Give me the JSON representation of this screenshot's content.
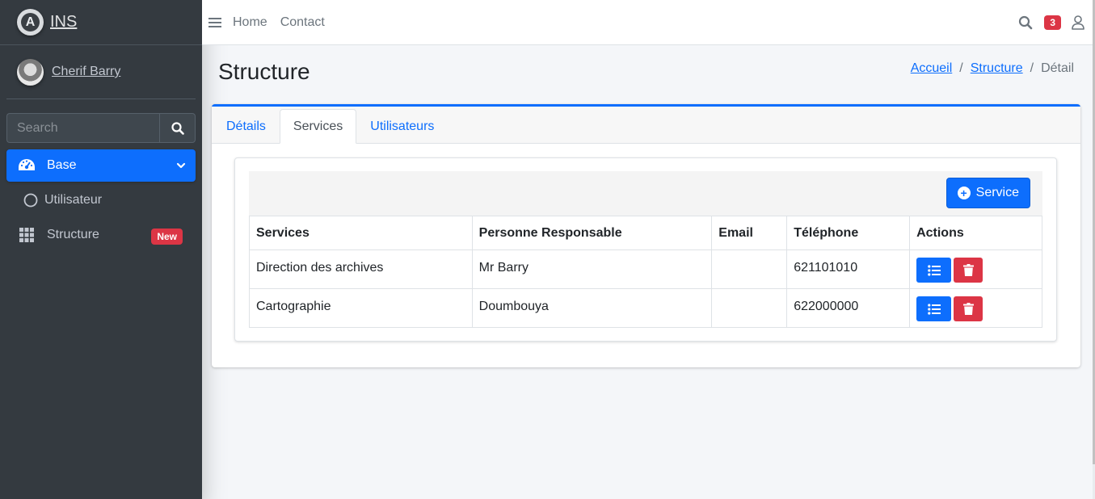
{
  "brand": {
    "name": "INS",
    "logo_letter": "A"
  },
  "user": {
    "name": "Cherif Barry"
  },
  "sidebar": {
    "search_placeholder": "Search",
    "items": [
      {
        "label": "Base",
        "icon": "tachometer-icon",
        "active": true
      },
      {
        "label": "Utilisateur",
        "icon": "circle-icon"
      },
      {
        "label": "Structure",
        "icon": "grid-icon",
        "badge": "New"
      }
    ]
  },
  "topnav": {
    "links": [
      "Home",
      "Contact"
    ],
    "notification_count": "3"
  },
  "page": {
    "title": "Structure",
    "breadcrumb": [
      "Accueil",
      "Structure",
      "Détail"
    ]
  },
  "tabs": [
    "Détails",
    "Services",
    "Utilisateurs"
  ],
  "active_tab": "Services",
  "table": {
    "add_button": "Service",
    "headers": [
      "Services",
      "Personne Responsable",
      "Email",
      "Téléphone",
      "Actions"
    ],
    "rows": [
      {
        "service": "Direction des archives",
        "responsable": "Mr Barry",
        "email": "",
        "telephone": "621101010"
      },
      {
        "service": "Cartographie",
        "responsable": "Doumbouya",
        "email": "",
        "telephone": "622000000"
      }
    ]
  },
  "colors": {
    "primary": "#0d6efd",
    "danger": "#dc3545",
    "sidebar": "#343a40"
  }
}
